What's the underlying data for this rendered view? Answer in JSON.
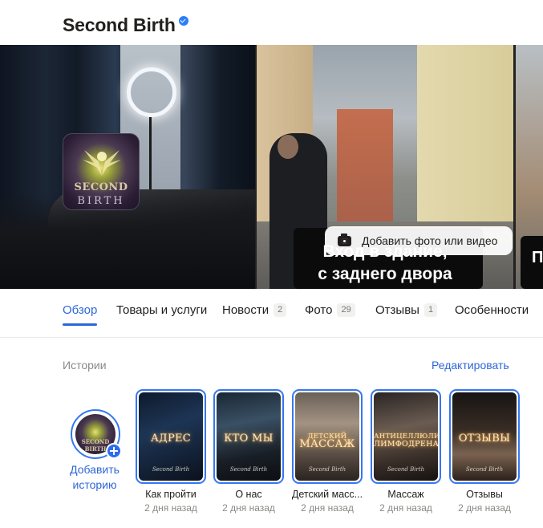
{
  "header": {
    "title": "Second Birth",
    "verified_icon": "verified-check-icon"
  },
  "gallery": {
    "avatar_logo_line1": "SECOND",
    "avatar_logo_line2": "BIRTH",
    "caption_line1": "Вход в здание,",
    "caption_line2": "с заднего двора",
    "caption_partial": "П",
    "add_photo_label": "Добавить фото или видео",
    "add_photo_icon": "camera-icon"
  },
  "tabs": [
    {
      "label": "Обзор",
      "badge": null,
      "active": true
    },
    {
      "label": "Товары и услуги",
      "badge": null,
      "active": false
    },
    {
      "label": "Новости",
      "badge": "2",
      "active": false
    },
    {
      "label": "Фото",
      "badge": "29",
      "active": false
    },
    {
      "label": "Отзывы",
      "badge": "1",
      "active": false
    },
    {
      "label": "Особенности",
      "badge": null,
      "active": false
    }
  ],
  "stories": {
    "section_label": "Истории",
    "edit_label": "Редактировать",
    "add_story_label": "Добавить историю",
    "add_story_logo": "SECOND BIRTH",
    "brand_watermark": "Second Birth",
    "items": [
      {
        "thumb_text": "АДРЕС",
        "thumb_sub": "",
        "title": "Как пройти",
        "time": "2 дня назад"
      },
      {
        "thumb_text": "КТО МЫ",
        "thumb_sub": "",
        "title": "О нас",
        "time": "2 дня назад"
      },
      {
        "thumb_text": "ДЕТСКИЙ",
        "thumb_sub": "МАССАЖ",
        "title": "Детский масс...",
        "time": "2 дня назад"
      },
      {
        "thumb_text": "АНТИЦЕЛЛЮЛИТ",
        "thumb_sub": "ЛИМФОДРЕНАЖ",
        "title": "Массаж",
        "time": "2 дня назад"
      },
      {
        "thumb_text": "ОТЗЫВЫ",
        "thumb_sub": "",
        "title": "Отзывы",
        "time": "2 дня назад"
      }
    ]
  },
  "colors": {
    "accent": "#2f67d8",
    "story_ring": "#3577f0",
    "text": "#21201f",
    "muted": "#8a8985"
  }
}
